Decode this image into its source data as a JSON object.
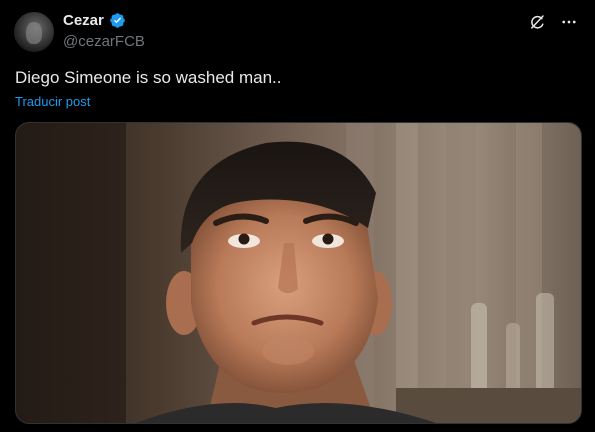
{
  "author": {
    "display_name": "Cezar",
    "handle": "@cezarFCB",
    "verified": true,
    "verified_color": "#1d9bf0"
  },
  "post": {
    "text": "Diego Simeone is so washed man..",
    "translate_label": "Traducir post"
  },
  "icons": {
    "grok": "grok-icon",
    "more": "more-icon",
    "verified": "verified-badge-icon"
  },
  "colors": {
    "background": "#000000",
    "text": "#e7e9ea",
    "muted": "#71767b",
    "link": "#1d9bf0"
  },
  "media": {
    "kind": "photo"
  }
}
